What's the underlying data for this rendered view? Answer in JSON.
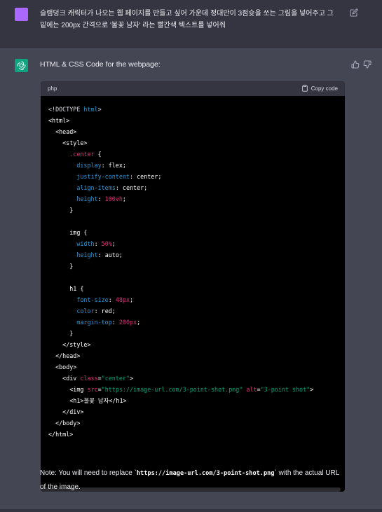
{
  "user": {
    "message": "슬램덩크 캐릭터가 나오는 웹 페이지를 만들고 싶어 가운데 정대만이 3점슛을 쏘는 그림을 넣어주고 그 밑에는 200px 간격으로 '불꽃 남자' 라는 빨간색 텍스트를 넣어줘"
  },
  "assistant": {
    "intro": "HTML & CSS Code for the webpage:",
    "code_block": {
      "language": "php",
      "copy_label": "Copy code"
    },
    "note_prefix": "Note: You will need to replace `",
    "note_code": "https://image-url.com/3-point-shot.png",
    "note_suffix": "` with the actual URL of the image."
  },
  "colors": {
    "user_avatar": "#ab68ff",
    "bot_avatar": "#10a37f"
  },
  "icons": [
    "edit-icon",
    "thumbs-up-icon",
    "thumbs-down-icon",
    "clipboard-icon",
    "openai-logo-icon"
  ]
}
